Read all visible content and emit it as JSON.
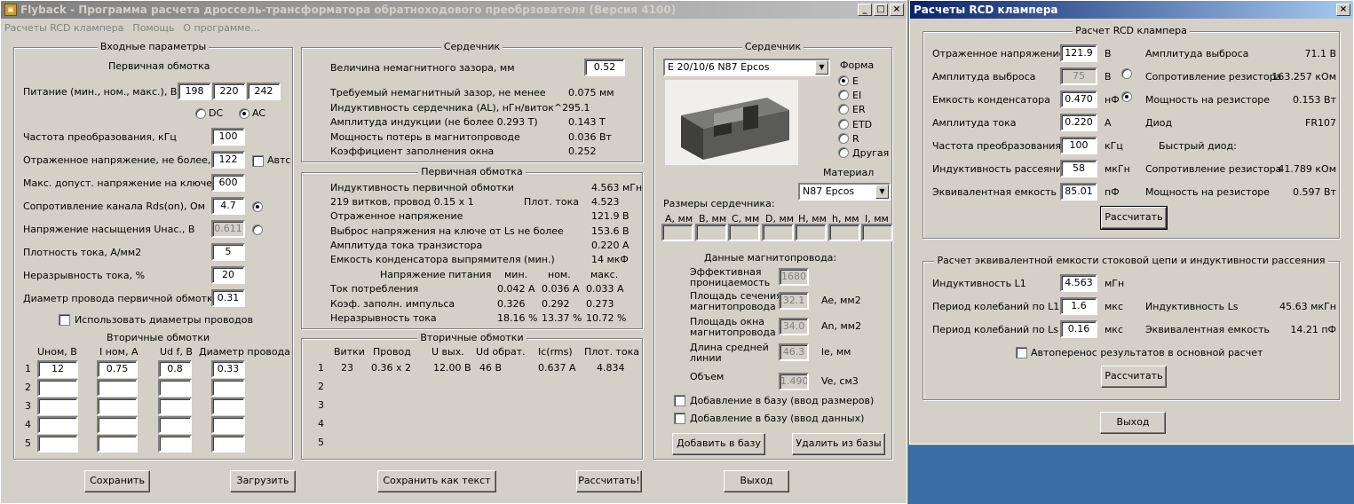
{
  "main": {
    "title": "Flyback - Программа расчета дроссель-трансформатора обратноходового преобрзователя (Версия 4100)",
    "menu": [
      "Расчеты RCD клампера",
      "Помощь",
      "О программе..."
    ],
    "input": {
      "group_title": "Входные параметры",
      "primary_title": "Первичная обмотка",
      "supply_label": "Питание (мин., ном., макс.), В",
      "supply_min": "198",
      "supply_nom": "220",
      "supply_max": "242",
      "dc": "DC",
      "ac": "AC",
      "rows": [
        {
          "label": "Частота преобразования, кГц",
          "value": "100"
        },
        {
          "label": "Отраженное напряжение, не более, В",
          "value": "122"
        },
        {
          "label": "Макс. допуст. напряжение на ключе, В",
          "value": "600"
        },
        {
          "label": "Сопротивление канала Rds(on), Ом",
          "value": "4.7"
        },
        {
          "label": "Напряжение насыщения Uнас., В",
          "value": "0.611"
        },
        {
          "label": "Плотность тока, А/мм2",
          "value": "5"
        },
        {
          "label": "Неразрывность тока, %",
          "value": "20"
        },
        {
          "label": "Диаметр провода первичной обмотки",
          "value": "0.31"
        }
      ],
      "auto_label": "Автс",
      "use_diam_label": "Использовать диаметры проводов",
      "secondary_title": "Вторичные обмотки",
      "sec_headers": [
        "Uном, В",
        "I ном, А",
        "Ud f, В",
        "Диаметр провода"
      ],
      "sec_rows": [
        {
          "n": "1",
          "u": "12",
          "i": "0.75",
          "ud": "0.8",
          "d": "0.33"
        },
        {
          "n": "2",
          "u": "",
          "i": "",
          "ud": "",
          "d": ""
        },
        {
          "n": "3",
          "u": "",
          "i": "",
          "ud": "",
          "d": ""
        },
        {
          "n": "4",
          "u": "",
          "i": "",
          "ud": "",
          "d": ""
        },
        {
          "n": "5",
          "u": "",
          "i": "",
          "ud": "",
          "d": ""
        }
      ]
    },
    "core_calc": {
      "group_title": "Сердечник",
      "gap_label": "Величина немагнитного зазора, мм",
      "gap_value": "0.52",
      "rows": [
        {
          "label": "Требуемый немагнитный зазор, не менее",
          "value": "0.075 мм"
        },
        {
          "label": "Индуктивность сердечника (AL), нГн/виток^2",
          "value": "95.1"
        },
        {
          "label": "Амплитуда индукции     (не более 0.293 Т)",
          "value": "0.143 Т"
        },
        {
          "label": "Мощность потерь в магнитопроводе",
          "value": "0.036 Вт"
        },
        {
          "label": "Коэффициент заполнения окна",
          "value": "0.252"
        }
      ]
    },
    "primary": {
      "group_title": "Первичная обмотка",
      "rows": [
        {
          "label": "Индуктивность первичной обмотки",
          "value": "4.563 мГн"
        },
        {
          "label": "219 витков,  провод 0.15 x 1",
          "mid": "Плот. тока",
          "value": "4.523"
        },
        {
          "label": "Отраженное напряжение",
          "value": "121.9 В"
        },
        {
          "label": "Выброс напряжения на ключе от Ls не более",
          "value": "153.6 В"
        },
        {
          "label": "Амплитуда тока транзистора",
          "value": "0.220 А"
        },
        {
          "label": "Емкость конденсатора выпрямителя (мин.)",
          "value": "14 мкФ"
        }
      ],
      "supply_header": "Напряжение питания",
      "col_headers": [
        "мин.",
        "ном.",
        "макс."
      ],
      "table": [
        {
          "label": "Ток потребления",
          "v": [
            "0.042 А",
            "0.036 А",
            "0.033 А"
          ]
        },
        {
          "label": "Коэф. заполн. импульса",
          "v": [
            "0.326",
            "0.292",
            "0.273"
          ]
        },
        {
          "label": "Неразрывность тока",
          "v": [
            "18.16 %",
            "13.37 %",
            "10.72 %"
          ]
        }
      ]
    },
    "secondary_out": {
      "group_title": "Вторичные обмотки",
      "headers": [
        "Витки",
        "Провод",
        "U вых.",
        "Ud обрат.",
        "Ic(rms)",
        "Плот. тока"
      ],
      "rows": [
        {
          "n": "1",
          "v": [
            "23",
            "0.36 x 2",
            "12.00 В",
            "46 В",
            "0.637 А",
            "4.834"
          ]
        },
        {
          "n": "2",
          "v": [
            "",
            "",
            "",
            "",
            "",
            ""
          ]
        },
        {
          "n": "3",
          "v": [
            "",
            "",
            "",
            "",
            "",
            ""
          ]
        },
        {
          "n": "4",
          "v": [
            "",
            "",
            "",
            "",
            "",
            ""
          ]
        },
        {
          "n": "5",
          "v": [
            "",
            "",
            "",
            "",
            "",
            ""
          ]
        }
      ]
    },
    "core_sel": {
      "group_title": "Сердечник",
      "core_value": "E 20/10/6 N87 Epcos",
      "shape_label": "Форма",
      "shapes": [
        "E",
        "EI",
        "ER",
        "ETD",
        "R",
        "Другая"
      ],
      "material_label": "Материал",
      "material_value": "N87 Epcos",
      "dims_label": "Размеры сердечника:",
      "dims": [
        "A, мм",
        "B, мм",
        "C, мм",
        "D, мм",
        "H, мм",
        "h, мм",
        "I, мм"
      ],
      "mag_title": "Данные магнитопровода:",
      "mag": [
        {
          "label1": "Эффективная",
          "label2": "проницаемость",
          "value": "1680",
          "unit": ""
        },
        {
          "label1": "Площадь сечения",
          "label2": "магнитопровода",
          "value": "32.1",
          "unit": "Ae, мм2"
        },
        {
          "label1": "Площадь окна",
          "label2": "магнитопровода",
          "value": "34.0",
          "unit": "An, мм2"
        },
        {
          "label1": "Длина средней",
          "label2": "линии",
          "value": "46.3",
          "unit": "le, мм"
        },
        {
          "label1": "Объем",
          "label2": "",
          "value": "1.490",
          "unit": "Ve, см3"
        }
      ],
      "chk_size": "Добавление в базу (ввод размеров)",
      "chk_data": "Добавление в базу (ввод данных)",
      "add_btn": "Добавить в базу",
      "del_btn": "Удалить из базы"
    },
    "buttons": {
      "save": "Сохранить",
      "load": "Загрузить",
      "save_text": "Сохранить как текст",
      "calc": "Рассчитать!",
      "exit": "Выход"
    }
  },
  "rcd": {
    "title": "Расчеты RCD клампера",
    "group1_title": "Расчет RCD клампера",
    "left": [
      {
        "label": "Отраженное напряжение",
        "value": "121.9",
        "unit": "В"
      },
      {
        "label": "Амплитуда выброса",
        "value": "75",
        "unit": "В"
      },
      {
        "label": "Емкость конденсатора",
        "value": "0.470",
        "unit": "нФ"
      },
      {
        "label": "Амплитуда тока",
        "value": "0.220",
        "unit": "А"
      },
      {
        "label": "Частота преобразования",
        "value": "100",
        "unit": "кГц"
      },
      {
        "label": "Индуктивность рассеяния",
        "value": "58",
        "unit": "мкГн"
      },
      {
        "label": "Эквивалентная емкость",
        "value": "85.01",
        "unit": "пФ"
      }
    ],
    "right": [
      {
        "label": "Амплитуда выброса",
        "value": "71.1 В"
      },
      {
        "label": "Сопротивление резистора",
        "value": "163.257 кОм"
      },
      {
        "label": "Мощность на резисторе",
        "value": "0.153 Вт"
      },
      {
        "label": "Диод",
        "value": "FR107"
      },
      {
        "label": "Быстрый диод:",
        "value": ""
      },
      {
        "label": "Сопротивление резистора",
        "value": "41.789 кОм"
      },
      {
        "label": "Мощность на резисторе",
        "value": "0.597 Вт"
      }
    ],
    "calc1": "Рассчитать",
    "group2_title": "Расчет эквивалентной емкости стоковой цепи и индуктивности рассеяния",
    "left2": [
      {
        "label": "Индуктивность L1",
        "value": "4.563",
        "unit": "мГн"
      },
      {
        "label": "Период колебаний по L1",
        "value": "1.6",
        "unit": "мкс"
      },
      {
        "label": "Период колебаний по Ls",
        "value": "0.16",
        "unit": "мкс"
      }
    ],
    "right2": [
      {
        "label": "Индуктивность Ls",
        "value": "45.63 мкГн"
      },
      {
        "label": "Эквивалентная емкость",
        "value": "14.21 пФ"
      }
    ],
    "auto_label": "Автоперенос результатов в основной расчет",
    "calc2": "Рассчитать",
    "exit": "Выход"
  }
}
